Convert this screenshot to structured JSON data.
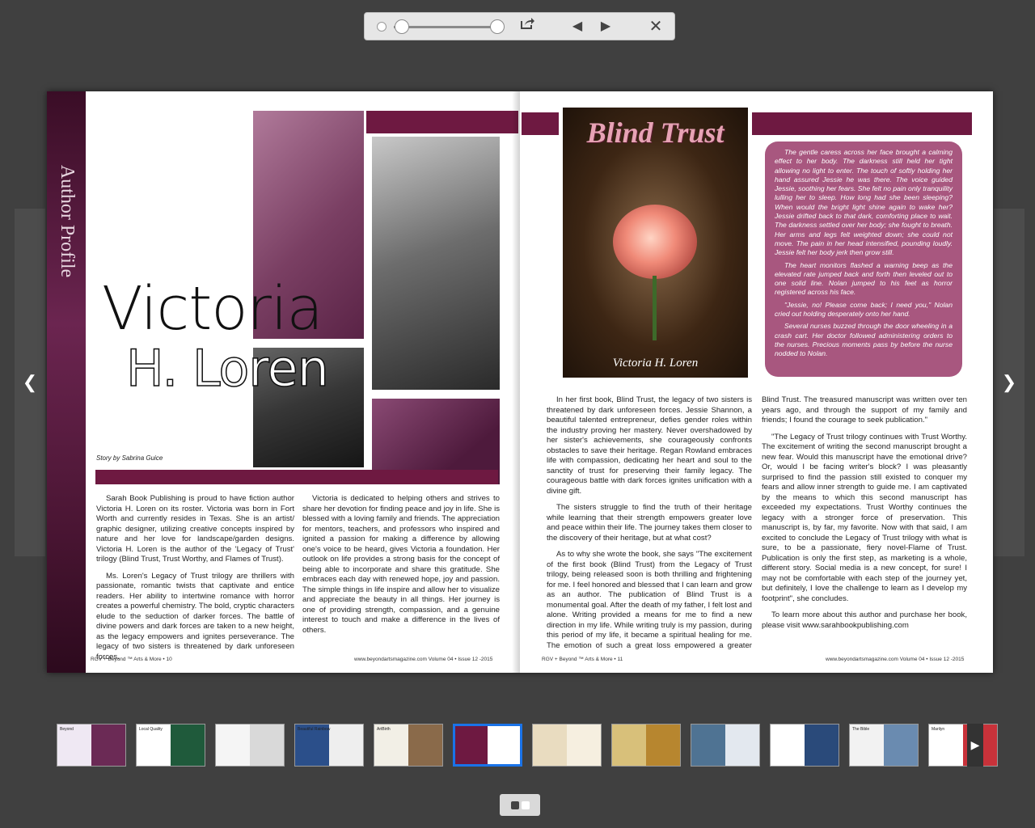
{
  "toolbar": {
    "zoom_level": 0.02,
    "icons": [
      "zoom-handle-icon",
      "zoom-min-icon",
      "zoom-max-icon",
      "share-icon",
      "prev-page-icon",
      "next-page-icon",
      "close-icon"
    ]
  },
  "side_nav": {
    "prev_icon": "chevron-left-icon",
    "next_icon": "chevron-right-icon"
  },
  "left_page": {
    "section_label": "Author Profile",
    "headline_line1": "Victoria",
    "headline_line2": "H. Loren",
    "byline": "Story by Sabrina Guice",
    "col1_p1": "Sarah Book Publishing is proud to have fiction author Victoria H. Loren on its roster. Victoria was born in Fort Worth and currently resides in Texas. She is an artist/ graphic designer, utilizing creative concepts inspired by nature and her love for landscape/garden designs. Victoria H. Loren is the author of the 'Legacy of Trust' trilogy (Blind Trust, Trust Worthy, and Flames of Trust).",
    "col1_p2": "Ms. Loren's Legacy of Trust trilogy are thrillers with passionate, romantic twists that captivate and entice readers. Her ability to intertwine romance with horror creates a powerful chemistry. The bold, cryptic characters elude to the seduction of darker forces. The battle of divine powers and dark forces are taken to a new height, as the legacy empowers and ignites perseverance. The legacy of two sisters is threatened by dark unforeseen forces.",
    "col2_p1": "Victoria is dedicated to helping others and strives to share her devotion for finding peace and joy in life. She is blessed with a loving family and friends. The appreciation for mentors, teachers, and professors who inspired and ignited a passion for making a difference by allowing one's voice to be heard, gives Victoria a foundation. Her outlook on life provides a strong basis for the concept of being able to incorporate and share this gratitude. She embraces each day with renewed hope, joy and passion. The simple things in life inspire and allow her to visualize and appreciate the beauty in all things. Her journey is one of providing strength, compassion, and a genuine interest to touch and make a difference in the lives of others.",
    "footer_left": "RGV + Beyond ™ Arts & More  •  10",
    "footer_right": "www.beyondartsmagazine.com     Volume 04 • Issue 12 -2015"
  },
  "right_page": {
    "book_title": "Blind Trust",
    "book_author": "Victoria H. Loren",
    "excerpt": [
      "The gentle caress across her face brought a calming effect to her body. The darkness still held her tight allowing no light to enter. The touch of softly holding her hand assured Jessie he was there. The voice guided Jessie, soothing her fears. She felt no pain only tranquility lulling her to sleep. How long had she been sleeping? When would the bright light shine again to wake her? Jessie drifted back to that dark, comforting place to wait. The darkness settled over her body; she fought to breath. Her arms and legs felt weighted down; she could not move. The pain in her head intensified, pounding loudly. Jessie felt her body jerk then grow still.",
      "The heart monitors flashed a warning beep as the elevated rate jumped back and forth then leveled out to one solid line. Nolan jumped to his feet as horror registered across his face.",
      "\"Jessie, no! Please come back; I need you,\" Nolan cried out holding desperately onto her hand.",
      "Several nurses buzzed through the door wheeling in a crash cart. Her doctor followed administering orders to the nurses. Precious moments pass by before the nurse nodded to Nolan."
    ],
    "col1_p1": "In her first book, Blind Trust, the legacy of two sisters is threatened by dark unforeseen forces. Jessie Shannon, a beautiful talented entrepreneur, defies gender roles within the industry proving her mastery. Never overshadowed by her sister's achievements, she courageously confronts obstacles to save their heritage. Regan Rowland embraces life with compassion, dedicating her heart and soul to the sanctity of trust for preserving their family legacy. The courageous battle with dark forces ignites unification with a divine gift.",
    "col1_p2": "The sisters struggle to find the truth of their heritage while learning that their strength empowers greater love and peace within their life. The journey takes them closer to the discovery of their heritage, but at what cost?",
    "col1_p3": "As to why she wrote the book, she says \"The excitement of the first book (Blind Trust) from the Legacy of Trust trilogy, being released soon is both thrilling and frightening for me. I feel honored and blessed that I can learn and grow as an author. The publication of Blind Trust is a monumental goal. After the death of my father, I felt lost and alone. Writing provided a means for me to find a new direction in my life. While writing truly is my passion, during this period of my life, it became a spiritual healing for me. The emotion of such a great loss empowered a greater feeling of love and peace. I am extremely proud of the completion and publication of",
    "col2_p1": "Blind Trust. The treasured manuscript was written over ten years ago, and through the support of my family and friends; I found the courage to seek publication.\"",
    "col2_p2": "\"The Legacy of Trust trilogy continues with Trust Worthy. The excitement of writing the second manuscript brought a new fear. Would this manuscript have the emotional drive? Or, would I be facing writer's block? I was pleasantly surprised to find the passion still existed to conquer my fears and allow inner strength to guide me. I am captivated by the means to which this second manuscript has exceeded my expectations. Trust Worthy continues the legacy with a stronger force of preservation. This manuscript is, by far, my favorite. Now with that said, I am excited to conclude the Legacy of Trust trilogy with what is sure, to be a passionate, fiery novel-Flame of Trust. Publication is only the first step, as marketing is a whole, different story. Social media is a new concept, for sure! I may not be comfortable with each step of the journey yet, but definitely, I love the challenge to learn as I develop my footprint\", she concludes.",
    "col2_p3": "To learn more about this author and purchase her book, please visit www.sarahbookpublishing.com",
    "footer_left": "RGV + Beyond ™ Arts & More  •  11",
    "footer_right": "www.beyondartsmagazine.com     Volume 04 • Issue 12 -2015"
  },
  "thumbnails": {
    "count": 12,
    "active_index": 5,
    "labels": [
      "Beyond",
      "Local Quality",
      "",
      "Beautiful Rainbow",
      "ArtBirth",
      "",
      "",
      "",
      "",
      "",
      "The Bible",
      "Marilyn"
    ],
    "more_icon": "chevron-right-icon"
  },
  "view_toggle": {
    "icon": "two-page-view-icon"
  },
  "colors": {
    "plum": "#6e1941",
    "mauve": "#a8577f",
    "active_thumb": "#1a73e8"
  }
}
